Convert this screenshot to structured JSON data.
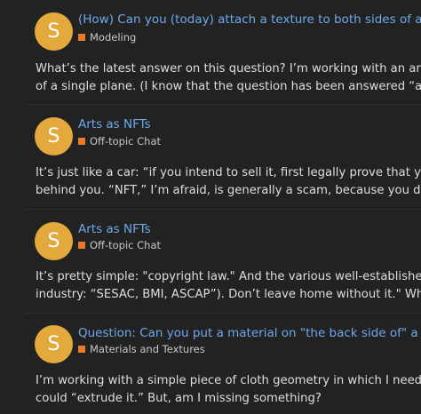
{
  "colors": {
    "background": "#222222",
    "avatar": "#e4a93c",
    "title_link": "#6ea9ea",
    "category_swatch": "#e87a2a"
  },
  "posts": [
    {
      "avatar_letter": "S",
      "title": "(How) Can you (today) attach a texture to both sides of a plane?",
      "category": "Modeling",
      "excerpt_lines": [
        "What’s the latest answer on this question? I’m working with an animated clo",
        "of a single plane. (I know that the question has been answered “a long time"
      ]
    },
    {
      "avatar_letter": "S",
      "title": "Arts as NFTs",
      "category": "Off-topic Chat",
      "excerpt_lines": [
        "It’s just like a car: “if you intend to sell it, first legally prove that you own it.” T",
        "behind you. “NFT,” I’m afraid, is generally a scam, because you do not know"
      ]
    },
    {
      "avatar_letter": "S",
      "title": "Arts as NFTs",
      "category": "Off-topic Chat",
      "excerpt_lines": [
        "It’s pretty simple: \"copyright law.\" And the various well-established business",
        "industry: “SESAC, BMI, ASCAP”). Don’t leave home without it.\" While “the la"
      ]
    },
    {
      "avatar_letter": "S",
      "title": "Question: Can you put a material on \"the back side of\" a plane?",
      "category": "Materials and Textures",
      "excerpt_lines": [
        "I’m working with a simple piece of cloth geometry in which I need to easily s",
        "could “extrude it.” But, am I missing something?"
      ]
    }
  ]
}
